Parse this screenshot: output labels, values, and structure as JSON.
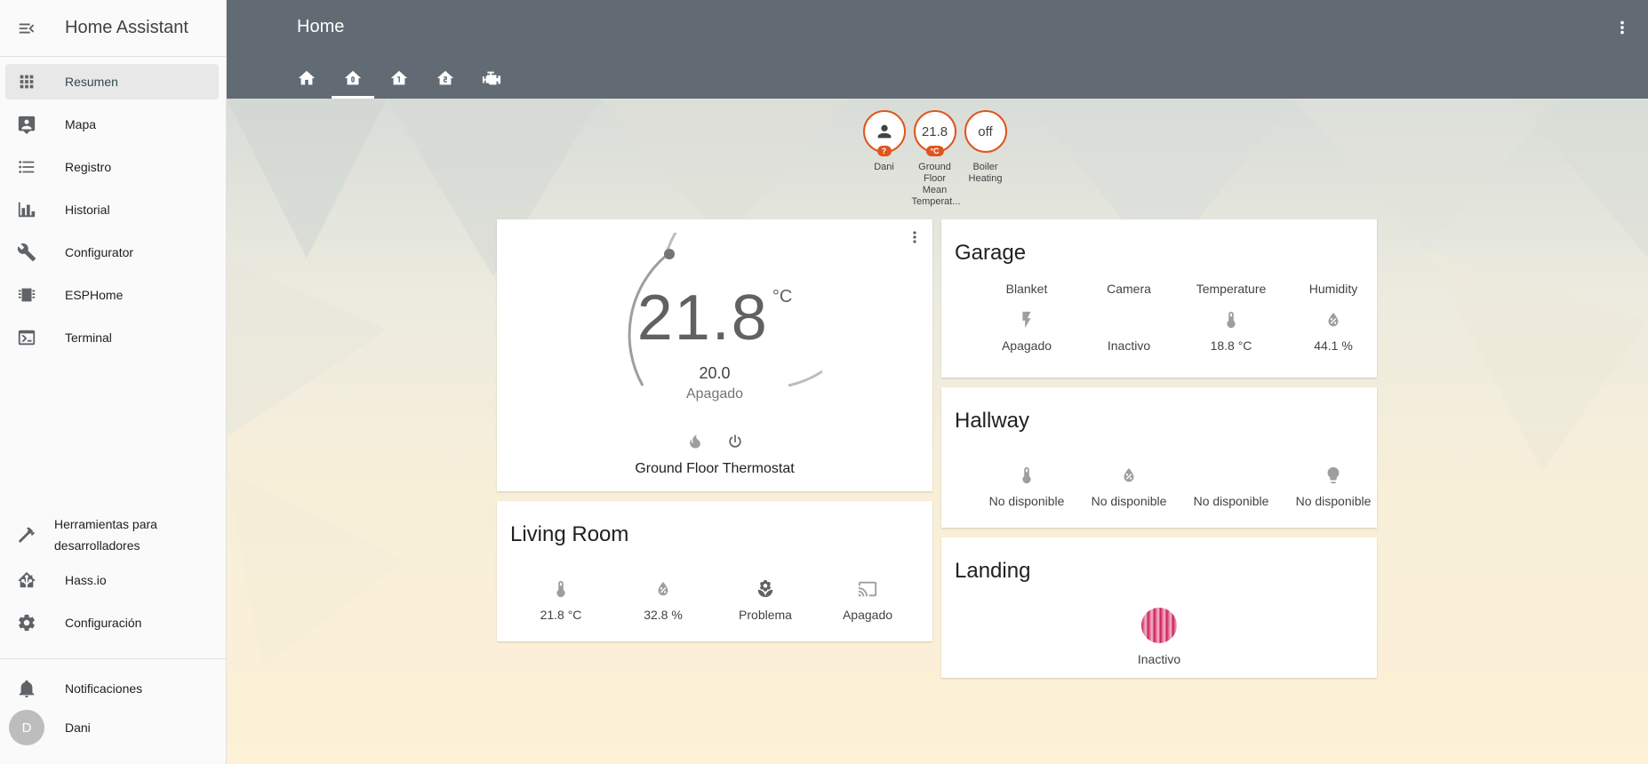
{
  "sidebar": {
    "title": "Home Assistant",
    "items": [
      {
        "label": "Resumen",
        "icon": "apps-icon"
      },
      {
        "label": "Mapa",
        "icon": "map-icon"
      },
      {
        "label": "Registro",
        "icon": "list-icon"
      },
      {
        "label": "Historial",
        "icon": "chart-icon"
      },
      {
        "label": "Configurator",
        "icon": "wrench-icon"
      },
      {
        "label": "ESPHome",
        "icon": "chip-icon"
      },
      {
        "label": "Terminal",
        "icon": "console-icon"
      }
    ],
    "bottom_items": [
      {
        "label": "Herramientas para desarrolladores",
        "icon": "hammer-icon"
      },
      {
        "label": "Hass.io",
        "icon": "home-assistant-icon"
      },
      {
        "label": "Configuración",
        "icon": "gear-icon"
      }
    ],
    "notifications": "Notificaciones",
    "user": {
      "initial": "D",
      "name": "Dani"
    }
  },
  "header": {
    "title": "Home",
    "tabs": [
      "home-icon",
      "home-floor-0-icon",
      "home-floor-1-icon",
      "home-floor-2-icon",
      "engine-icon"
    ]
  },
  "badges": [
    {
      "value": "",
      "tag": "?",
      "label": "Dani",
      "icon": "person-icon"
    },
    {
      "value": "21.8",
      "tag": "°C",
      "label": "Ground Floor Mean Temperat..."
    },
    {
      "value": "off",
      "tag": "",
      "label": "Boiler Heating"
    }
  ],
  "thermostat": {
    "current": "21.8",
    "unit": "°C",
    "target": "20.0",
    "mode": "Apagado",
    "name": "Ground Floor Thermostat"
  },
  "garage": {
    "title": "Garage",
    "entities": [
      {
        "name": "Blanket",
        "state": "Apagado",
        "icon": "flash-icon"
      },
      {
        "name": "Camera",
        "state": "Inactivo",
        "icon": "none"
      },
      {
        "name": "Temperature",
        "state": "18.8 °C",
        "icon": "thermometer-icon"
      },
      {
        "name": "Humidity",
        "state": "44.1 %",
        "icon": "water-percent-icon"
      }
    ]
  },
  "hallway": {
    "title": "Hallway",
    "entities": [
      {
        "state": "No disponible",
        "icon": "thermometer-icon"
      },
      {
        "state": "No disponible",
        "icon": "water-percent-icon"
      },
      {
        "state": "No disponible",
        "icon": "none"
      },
      {
        "state": "No disponible",
        "icon": "lightbulb-icon"
      }
    ]
  },
  "living_room": {
    "title": "Living Room",
    "entities": [
      {
        "state": "21.8 °C",
        "icon": "thermometer-icon"
      },
      {
        "state": "32.8 %",
        "icon": "water-percent-icon"
      },
      {
        "state": "Problema",
        "icon": "flower-icon"
      },
      {
        "state": "Apagado",
        "icon": "cast-icon"
      }
    ]
  },
  "landing": {
    "title": "Landing",
    "entities": [
      {
        "state": "Inactivo",
        "icon": "camera-thumbnail"
      }
    ]
  },
  "colors": {
    "header_bg": "#626a74",
    "badge_accent": "#e0541e",
    "sidebar_active": "#e8e8e8"
  }
}
